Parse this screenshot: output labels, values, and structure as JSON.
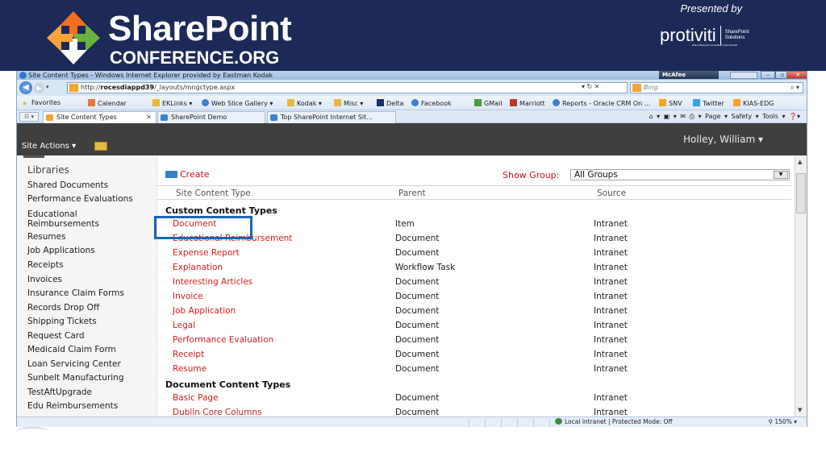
{
  "slide": {
    "brand_title": "SharePoint",
    "brand_subtitle": "CONFERENCE.ORG",
    "presented_by": "Presented by",
    "sponsor_name": "protiviti",
    "sponsor_tagline": "Risk & Business Consulting. Internal Audit.",
    "sponsor_division": "SharePoint Solutions",
    "colors": {
      "banner": "#1d2a57",
      "logo_orange": "#f26f21",
      "logo_green": "#6ab23e"
    }
  },
  "browser": {
    "window_title": "Site Content Types - Windows Internet Explorer provided by Eastman Kodak",
    "mcafee_label": "McAfee",
    "address_prefix": "http://",
    "address_host": "rocesdiappd39",
    "address_path": "/_layouts/mngctype.aspx",
    "search_placeholder": "Bing",
    "favorites": [
      {
        "label": "Favorites",
        "icon": "star-icon"
      },
      {
        "label": "Calendar",
        "icon": "calendar-icon"
      },
      {
        "label": "EKLinks ▾",
        "icon": "folder-icon"
      },
      {
        "label": "Web Slice Gallery ▾",
        "icon": "ie-icon"
      },
      {
        "label": "Kodak ▾",
        "icon": "folder-icon"
      },
      {
        "label": "Misc ▾",
        "icon": "folder-icon"
      },
      {
        "label": "Delta",
        "icon": "delta-icon"
      },
      {
        "label": "Facebook",
        "icon": "ie-icon"
      },
      {
        "label": "GMail",
        "icon": "gmail-icon"
      },
      {
        "label": "Marriott",
        "icon": "marriott-icon"
      },
      {
        "label": "Reports - Oracle CRM On ...",
        "icon": "ie-icon"
      },
      {
        "label": "SNV",
        "icon": "sharepoint-icon"
      },
      {
        "label": "Twitter",
        "icon": "twitter-icon"
      },
      {
        "label": "KIAS-EDG",
        "icon": "sharepoint-icon"
      }
    ],
    "tabs": [
      {
        "label": "Site Content Types",
        "active": true
      },
      {
        "label": "SharePoint Demo",
        "active": false
      },
      {
        "label": "Top SharePoint Internet Sit...",
        "active": false
      }
    ],
    "command_bar": "⌂ ▾  ▣ ▾  ✉  ⎙ ▾  Page ▾  Safety ▾  Tools ▾  ❓▾",
    "status_zone": "Local intranet | Protected Mode: Off",
    "status_zoom": "150%"
  },
  "sharepoint": {
    "site_actions": "Site Actions ▾",
    "user_name": "Holley, William ▾",
    "quick_launch": {
      "heading": "Libraries",
      "items": [
        "Shared Documents",
        "Performance Evaluations",
        "Educational Reimbursements",
        "Resumes",
        "Job Applications",
        "Receipts",
        "Invoices",
        "Insurance Claim Forms",
        "Records Drop Off",
        "Shipping Tickets",
        "Request Card",
        "Medicaid Claim Form",
        "Loan Servicing Center",
        "Sunbelt Manufacturing",
        "TestAftUpgrade",
        "Edu Reimbursements"
      ]
    },
    "toolbar": {
      "create_label": "Create",
      "show_group_label": "Show Group:",
      "show_group_value": "All Groups"
    },
    "columns": [
      "Site Content Type",
      "Parent",
      "Source"
    ],
    "groups": [
      {
        "name": "Custom Content Types",
        "rows": [
          {
            "name": "Document",
            "parent": "Item",
            "source": "Intranet"
          },
          {
            "name": "Educational Reimbursement",
            "parent": "Document",
            "source": "Intranet"
          },
          {
            "name": "Expense Report",
            "parent": "Document",
            "source": "Intranet"
          },
          {
            "name": "Explanation",
            "parent": "Workflow Task",
            "source": "Intranet"
          },
          {
            "name": "Interesting Articles",
            "parent": "Document",
            "source": "Intranet"
          },
          {
            "name": "Invoice",
            "parent": "Document",
            "source": "Intranet"
          },
          {
            "name": "Job Application",
            "parent": "Document",
            "source": "Intranet"
          },
          {
            "name": "Legal",
            "parent": "Document",
            "source": "Intranet"
          },
          {
            "name": "Performance Evaluation",
            "parent": "Document",
            "source": "Intranet"
          },
          {
            "name": "Receipt",
            "parent": "Document",
            "source": "Intranet"
          },
          {
            "name": "Resume",
            "parent": "Document",
            "source": "Intranet"
          }
        ]
      },
      {
        "name": "Document Content Types",
        "rows": [
          {
            "name": "Basic Page",
            "parent": "Document",
            "source": "Intranet"
          },
          {
            "name": "Dublin Core Columns",
            "parent": "Document",
            "source": "Intranet"
          }
        ]
      }
    ]
  }
}
